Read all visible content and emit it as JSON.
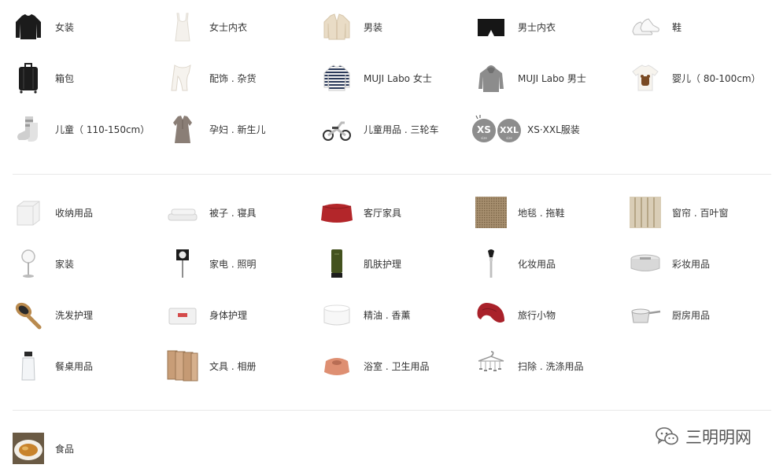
{
  "sections": [
    {
      "id": "apparel",
      "items": [
        {
          "label": "女装",
          "icon": "sweater-black-icon"
        },
        {
          "label": "女士内衣",
          "icon": "camisole-icon"
        },
        {
          "label": "男装",
          "icon": "cardigan-icon"
        },
        {
          "label": "男士内衣",
          "icon": "boxer-briefs-icon"
        },
        {
          "label": "鞋",
          "icon": "sneakers-icon"
        },
        {
          "label": "箱包",
          "icon": "suitcase-icon"
        },
        {
          "label": "配饰 . 杂货",
          "icon": "scarf-icon"
        },
        {
          "label": "MUJI Labo 女士",
          "icon": "striped-shirt-icon"
        },
        {
          "label": "MUJI Labo 男士",
          "icon": "hoodie-icon"
        },
        {
          "label": "婴儿（ 80-100cm）",
          "icon": "baby-tshirt-icon"
        },
        {
          "label": "儿童（ 110-150cm）",
          "icon": "kids-socks-icon"
        },
        {
          "label": "孕妇 . 新生儿",
          "icon": "maternity-dress-icon"
        },
        {
          "label": "儿童用品 . 三轮车",
          "icon": "balance-bike-icon"
        },
        {
          "label": "XS·XXL服装",
          "icon": "size-badges-icon",
          "badges": [
            "XS",
            "XXL"
          ],
          "badge_sub": "size"
        }
      ]
    },
    {
      "id": "household",
      "items": [
        {
          "label": "收纳用品",
          "icon": "storage-box-icon"
        },
        {
          "label": "被子 . 寝具",
          "icon": "bedding-icon"
        },
        {
          "label": "客厅家具",
          "icon": "red-pouf-icon"
        },
        {
          "label": "地毯 . 拖鞋",
          "icon": "rug-icon"
        },
        {
          "label": "窗帘 . 百叶窗",
          "icon": "curtain-icon"
        },
        {
          "label": "家装",
          "icon": "mirror-icon"
        },
        {
          "label": "家电 . 照明",
          "icon": "wall-speaker-icon"
        },
        {
          "label": "肌肤护理",
          "icon": "skincare-tube-icon"
        },
        {
          "label": "化妆用品",
          "icon": "makeup-brush-icon"
        },
        {
          "label": "彩妆用品",
          "icon": "cosmetic-case-icon"
        },
        {
          "label": "洗发护理",
          "icon": "hairbrush-icon"
        },
        {
          "label": "身体护理",
          "icon": "soap-bar-icon"
        },
        {
          "label": "精油 . 香薰",
          "icon": "aroma-diffuser-icon"
        },
        {
          "label": "旅行小物",
          "icon": "neck-pillow-icon"
        },
        {
          "label": "厨房用品",
          "icon": "saucepan-icon"
        },
        {
          "label": "餐桌用品",
          "icon": "glass-bottle-icon"
        },
        {
          "label": "文具 . 相册",
          "icon": "notebooks-icon"
        },
        {
          "label": "浴室 . 卫生用品",
          "icon": "toothbrush-stand-icon"
        },
        {
          "label": "扫除 . 洗涤用品",
          "icon": "hanger-rack-icon"
        }
      ]
    },
    {
      "id": "food",
      "items": [
        {
          "label": "食品",
          "icon": "curry-plate-icon"
        }
      ]
    }
  ],
  "watermark": {
    "text": "三明明网",
    "icon": "wechat-icon"
  },
  "colors": {
    "divider": "#e8e8e8",
    "text": "#333333",
    "accent_red": "#b3262a"
  }
}
